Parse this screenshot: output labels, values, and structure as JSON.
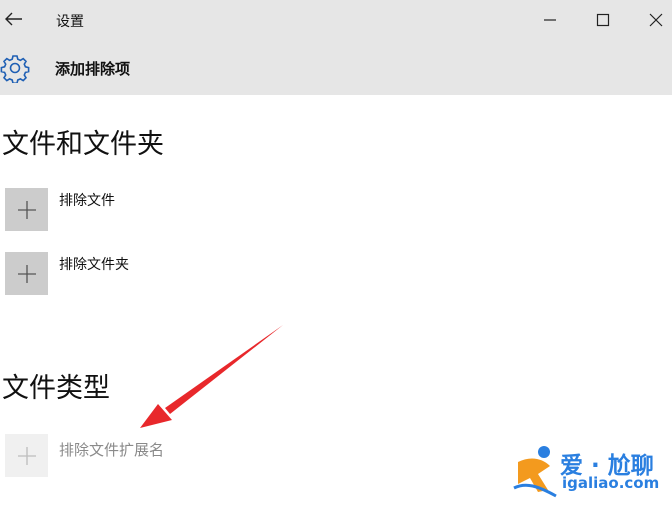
{
  "window": {
    "title": "设置",
    "minimize_glyph": "—",
    "maximize_glyph": "☐",
    "close_glyph": "✕"
  },
  "header": {
    "page_title": "添加排除项",
    "icon": "gear-icon"
  },
  "sections": {
    "files_and_folders": {
      "title": "文件和文件夹",
      "items": [
        {
          "label": "排除文件"
        },
        {
          "label": "排除文件夹"
        }
      ]
    },
    "file_types": {
      "title": "文件类型",
      "items": [
        {
          "label": "排除文件扩展名"
        }
      ]
    }
  },
  "annotation": {
    "arrow_color": "#e8282b"
  },
  "watermark": {
    "brand": "爱 · 尬聊",
    "url": "igaliao.com"
  },
  "colors": {
    "header_bg": "#e6e6e6",
    "button_bg": "#cccccc",
    "accent": "#2a7fe0"
  }
}
